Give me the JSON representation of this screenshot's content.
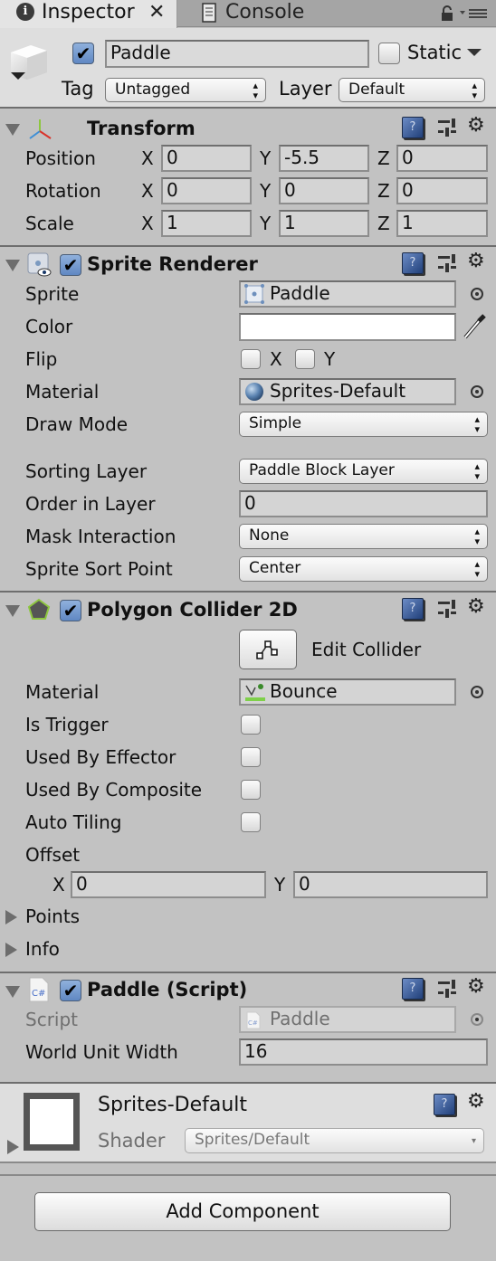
{
  "tabs": [
    {
      "label": "Inspector",
      "icon": "info-icon",
      "active": true
    },
    {
      "label": "Console",
      "icon": "console-icon",
      "active": false
    }
  ],
  "header": {
    "active": true,
    "name": "Paddle",
    "static_label": "Static",
    "static_checked": false,
    "tag_label": "Tag",
    "tag_value": "Untagged",
    "layer_label": "Layer",
    "layer_value": "Default"
  },
  "transform": {
    "title": "Transform",
    "rows": [
      {
        "label": "Position",
        "x": "0",
        "y": "-5.5",
        "z": "0"
      },
      {
        "label": "Rotation",
        "x": "0",
        "y": "0",
        "z": "0"
      },
      {
        "label": "Scale",
        "x": "1",
        "y": "1",
        "z": "1"
      }
    ],
    "axes": [
      "X",
      "Y",
      "Z"
    ]
  },
  "sprite_renderer": {
    "title": "Sprite Renderer",
    "enabled": true,
    "sprite_label": "Sprite",
    "sprite_value": "Paddle",
    "color_label": "Color",
    "color_value": "#ffffff",
    "flip_label": "Flip",
    "flip_x_label": "X",
    "flip_y_label": "Y",
    "material_label": "Material",
    "material_value": "Sprites-Default",
    "draw_mode_label": "Draw Mode",
    "draw_mode_value": "Simple",
    "sorting_layer_label": "Sorting Layer",
    "sorting_layer_value": "Paddle Block Layer",
    "order_label": "Order in Layer",
    "order_value": "0",
    "mask_label": "Mask Interaction",
    "mask_value": "None",
    "sort_point_label": "Sprite Sort Point",
    "sort_point_value": "Center"
  },
  "polygon_collider": {
    "title": "Polygon Collider 2D",
    "enabled": true,
    "edit_label": "Edit Collider",
    "material_label": "Material",
    "material_value": "Bounce",
    "is_trigger_label": "Is Trigger",
    "used_by_effector_label": "Used By Effector",
    "used_by_composite_label": "Used By Composite",
    "auto_tiling_label": "Auto Tiling",
    "offset_label": "Offset",
    "offset_x_label": "X",
    "offset_x": "0",
    "offset_y_label": "Y",
    "offset_y": "0",
    "points_label": "Points",
    "info_label": "Info"
  },
  "paddle_script": {
    "title": "Paddle (Script)",
    "enabled": true,
    "script_label": "Script",
    "script_value": "Paddle",
    "world_width_label": "World Unit Width",
    "world_width_value": "16"
  },
  "material_preview": {
    "name": "Sprites-Default",
    "shader_label": "Shader",
    "shader_value": "Sprites/Default"
  },
  "add_component_label": "Add Component",
  "icons": {
    "help": "?",
    "gear": "⚙",
    "checkmark": "✔",
    "close": "✕"
  }
}
